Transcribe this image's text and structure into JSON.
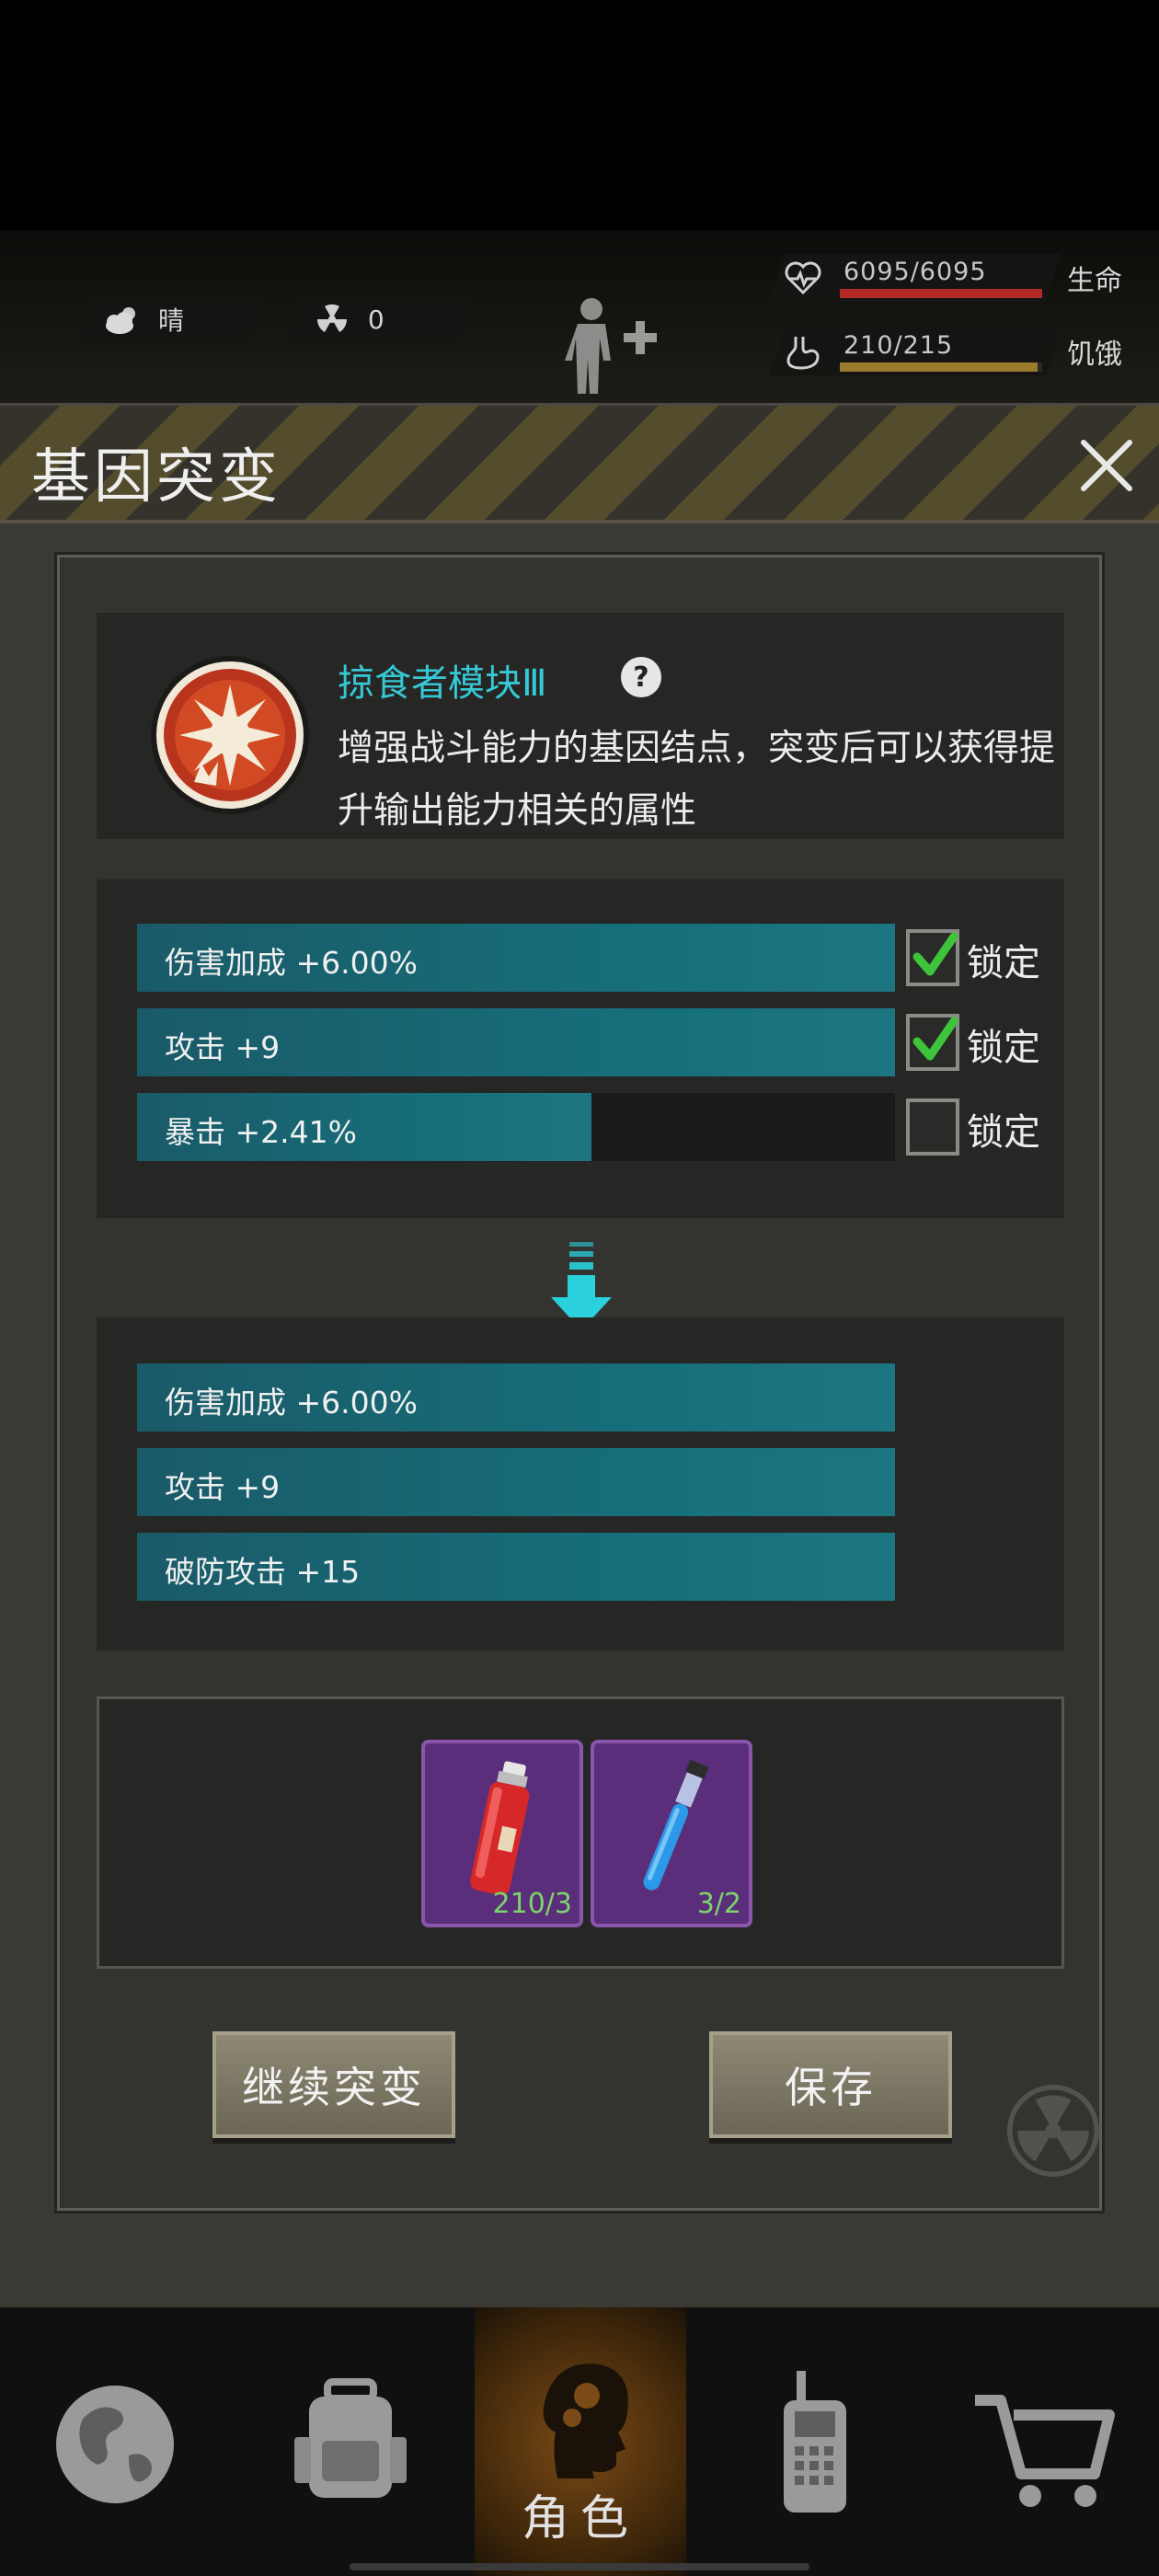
{
  "hud": {
    "weather": {
      "icon": "cloudy-sun-icon",
      "value": "晴"
    },
    "radiation": {
      "icon": "radiation-icon",
      "value": "0"
    },
    "health": {
      "value": "6095/6095",
      "label": "生命",
      "fill": 1.0,
      "color": "#b42a26"
    },
    "hunger": {
      "value": "210/215",
      "label": "饥饿",
      "fill": 0.977,
      "color": "#9a7a2c"
    }
  },
  "panel": {
    "title": "基因突变",
    "gene": {
      "name": "掠食者模块Ⅲ",
      "description": "增强战斗能力的基因结点，突变后可以获得提升输出能力相关的属性"
    },
    "current_attributes": [
      {
        "text": "伤害加成 +6.00%",
        "fill": 1.0,
        "locked": true,
        "lock_label": "锁定"
      },
      {
        "text": "攻击 +9",
        "fill": 1.0,
        "locked": true,
        "lock_label": "锁定"
      },
      {
        "text": "暴击 +2.41%",
        "fill": 0.6,
        "locked": false,
        "lock_label": "锁定"
      }
    ],
    "new_attributes": [
      {
        "text": "伤害加成 +6.00%",
        "fill": 1.0
      },
      {
        "text": "攻击 +9",
        "fill": 1.0
      },
      {
        "text": "破防攻击 +15",
        "fill": 1.0
      }
    ],
    "cost_items": [
      {
        "name": "red-serum-icon",
        "count": "210/3"
      },
      {
        "name": "blue-test-tube-icon",
        "count": "3/2"
      }
    ],
    "buttons": {
      "continue": "继续突变",
      "save": "保存"
    }
  },
  "nav": {
    "items": [
      {
        "icon": "globe-icon"
      },
      {
        "icon": "backpack-icon"
      },
      {
        "icon": "character-head-icon",
        "label": "角色",
        "active": true
      },
      {
        "icon": "walkie-talkie-icon"
      },
      {
        "icon": "shopping-cart-icon"
      }
    ]
  }
}
